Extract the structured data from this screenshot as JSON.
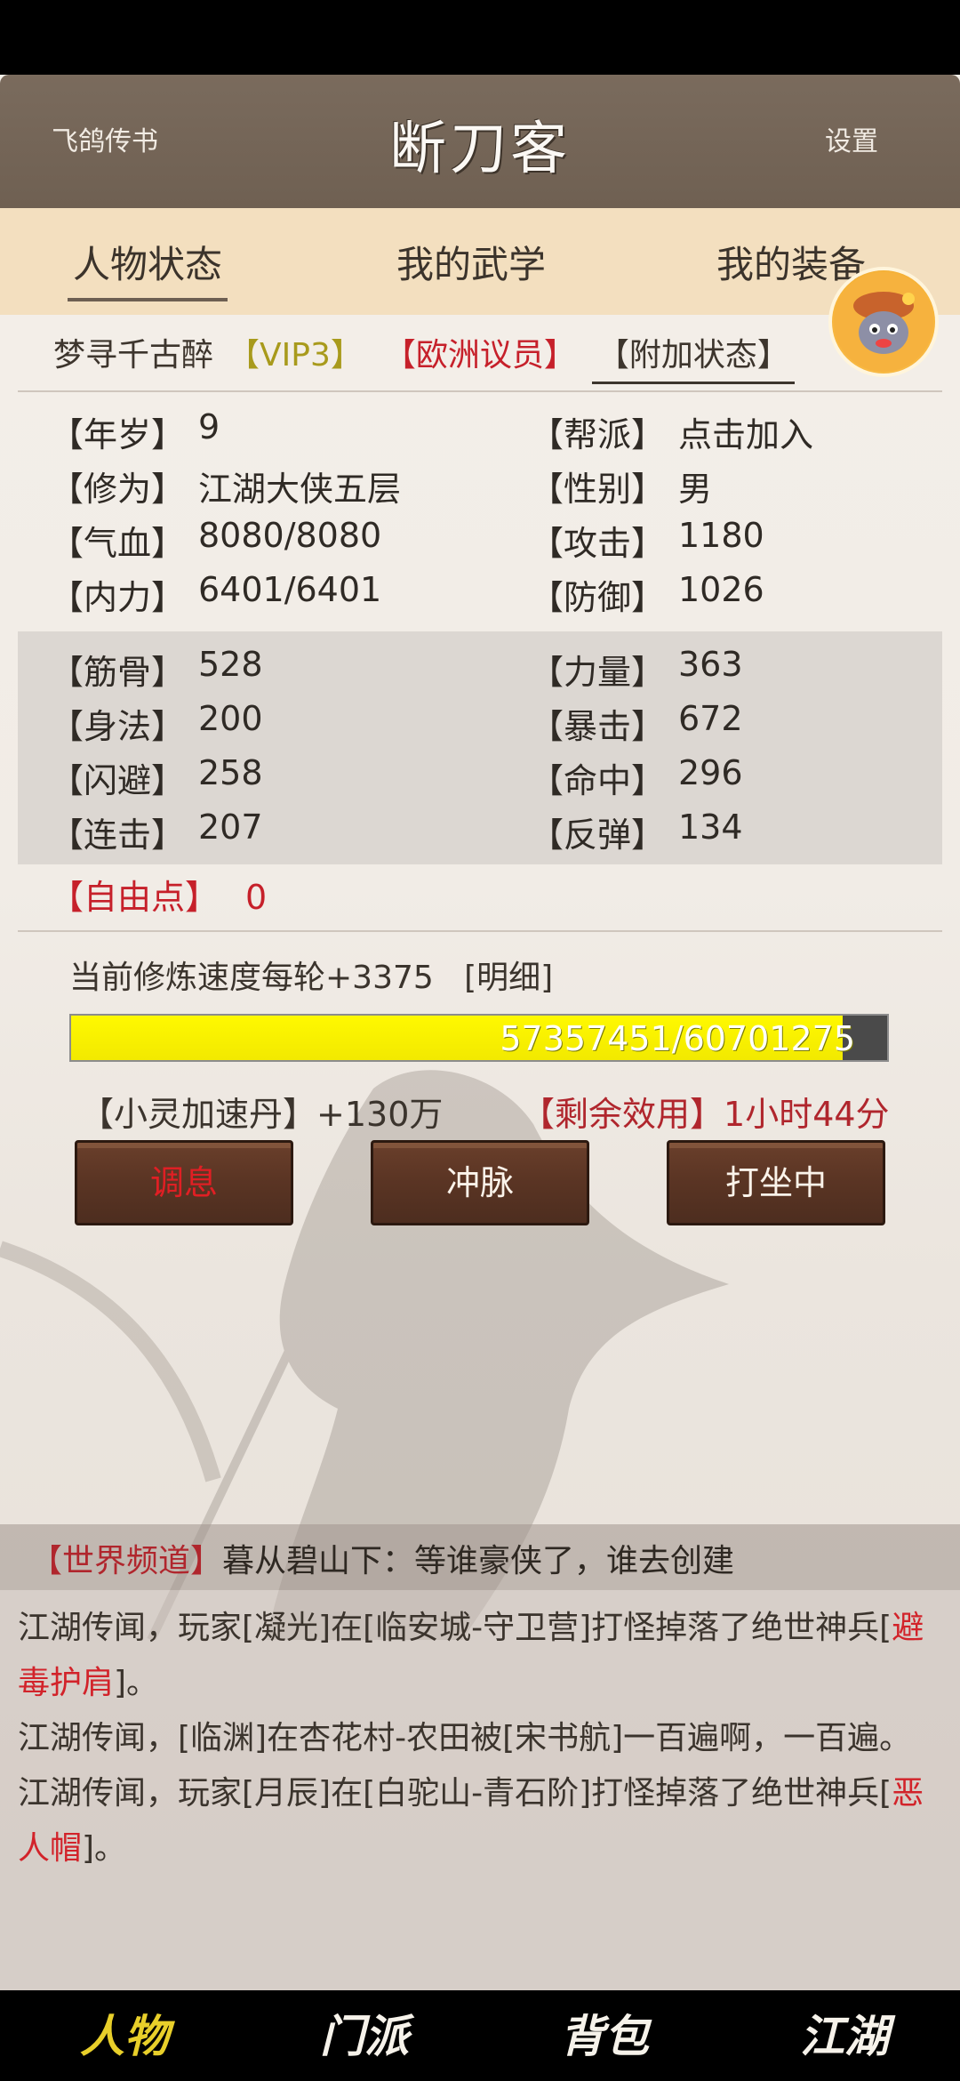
{
  "header": {
    "left_link": "飞鸽传书",
    "title": "断刀客",
    "right_link": "设置"
  },
  "tabs": [
    "人物状态",
    "我的武学",
    "我的装备"
  ],
  "profile": {
    "name": "梦寻千古醉",
    "vip": "【VIP3】",
    "rank": "【欧洲议员】",
    "extra_status": "【附加状态】"
  },
  "stats_basic": [
    {
      "label": "【年岁】",
      "value": "9",
      "label_r": "【帮派】",
      "value_r": "点击加入"
    },
    {
      "label": "【修为】",
      "value": "江湖大侠五层",
      "label_r": "【性别】",
      "value_r": "男"
    },
    {
      "label": "【气血】",
      "value": "8080/8080",
      "label_r": "【攻击】",
      "value_r": "1180"
    },
    {
      "label": "【内力】",
      "value": "6401/6401",
      "label_r": "【防御】",
      "value_r": "1026"
    }
  ],
  "stats_attr": [
    {
      "label": "【筋骨】",
      "value": "528",
      "label_r": "【力量】",
      "value_r": "363"
    },
    {
      "label": "【身法】",
      "value": "200",
      "label_r": "【暴击】",
      "value_r": "672"
    },
    {
      "label": "【闪避】",
      "value": "258",
      "label_r": "【命中】",
      "value_r": "296"
    },
    {
      "label": "【连击】",
      "value": "207",
      "label_r": "【反弹】",
      "value_r": "134"
    }
  ],
  "free_point": {
    "label": "【自由点】",
    "value": "0"
  },
  "cultivation": {
    "speed_text": "当前修炼速度每轮+3375",
    "detail_link": "[明细]",
    "progress_text": "57357451/60701275",
    "progress_ratio": 0.945
  },
  "pill": {
    "name": "【小灵加速丹】",
    "value": "+130万"
  },
  "effect": {
    "label": "【剩余效用】",
    "value": "1小时44分"
  },
  "actions": [
    "调息",
    "冲脉",
    "打坐中"
  ],
  "world_channel": {
    "channel": "【世界频道】",
    "message": "暮从碧山下：等谁豪侠了，谁去创建"
  },
  "news": [
    {
      "pre": "江湖传闻，玩家[凝光]在[临安城-守卫营]打怪掉落了绝世神兵[",
      "item": "避毒护肩",
      "post": "]。"
    },
    {
      "pre": "江湖传闻，[临渊]在杏花村-农田被[宋书航]一百遍啊，一百遍。",
      "item": "",
      "post": ""
    },
    {
      "pre": "江湖传闻，玩家[月辰]在[白驼山-青石阶]打怪掉落了绝世神兵[",
      "item": "恶人帽",
      "post": "]。"
    }
  ],
  "bottom_nav": [
    "人物",
    "门派",
    "背包",
    "江湖"
  ],
  "colors": {
    "header": "#74655a",
    "tab_bar": "#f3dfbf",
    "red_text": "#c6202a",
    "vip_text": "#a89a1c",
    "progress_fill": "#fff900",
    "button": "#5b3524",
    "nav_active": "#e8cf2a"
  }
}
